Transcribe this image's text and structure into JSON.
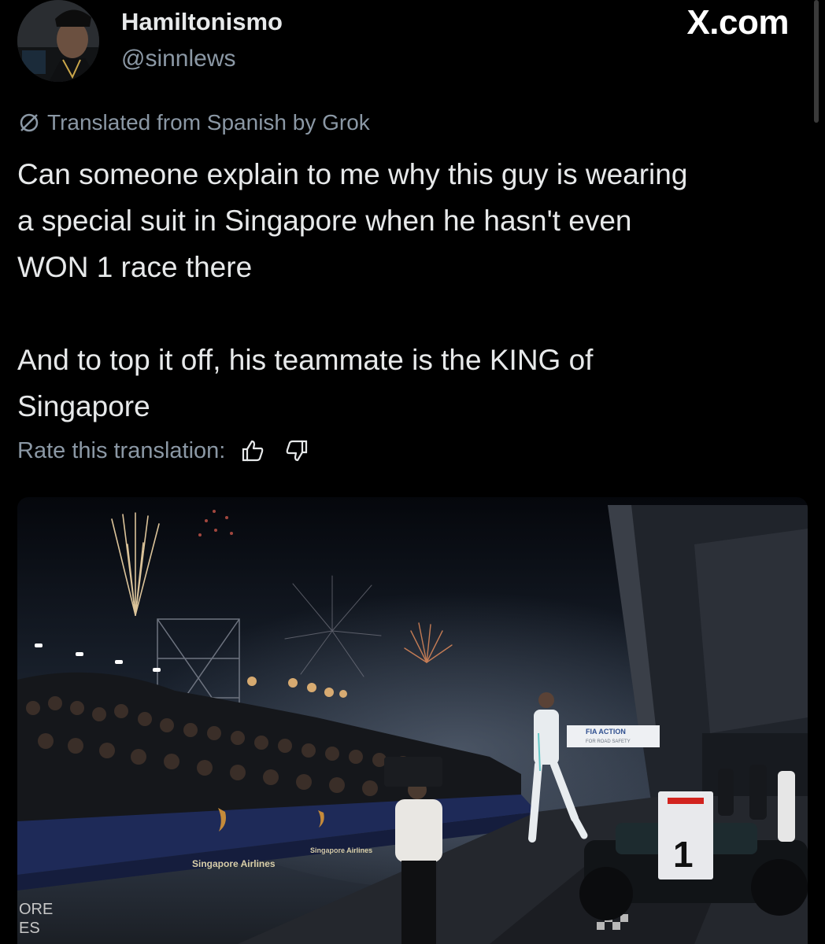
{
  "post": {
    "author_name": "Hamiltonismo",
    "author_handle": "@sinnlews",
    "brand": "X.com",
    "translated_label": "Translated from Spanish by Grok",
    "body": "Can someone explain to me why this guy is wearing\na special suit in Singapore when he hasn't even\nWON 1 race there\n\nAnd to top it off, his teammate is the KING of\nSingapore",
    "rate_label": "Rate this translation:"
  },
  "icons": {
    "translate": "no-sign-icon",
    "thumbs_up": "thumbs-up-icon",
    "thumbs_down": "thumbs-down-icon"
  },
  "photo": {
    "banner_text": "Singapore Airlines",
    "banner_text_2": "Singapore Airlines",
    "fia_sign_line1": "FIA ACTION",
    "fia_sign_line2": "FOR ROAD SAFETY",
    "corner_text_1": "ORE",
    "corner_text_2": "ES"
  },
  "colors": {
    "background": "#000000",
    "text_primary": "#e7e9ea",
    "text_secondary": "#8b98a5"
  }
}
